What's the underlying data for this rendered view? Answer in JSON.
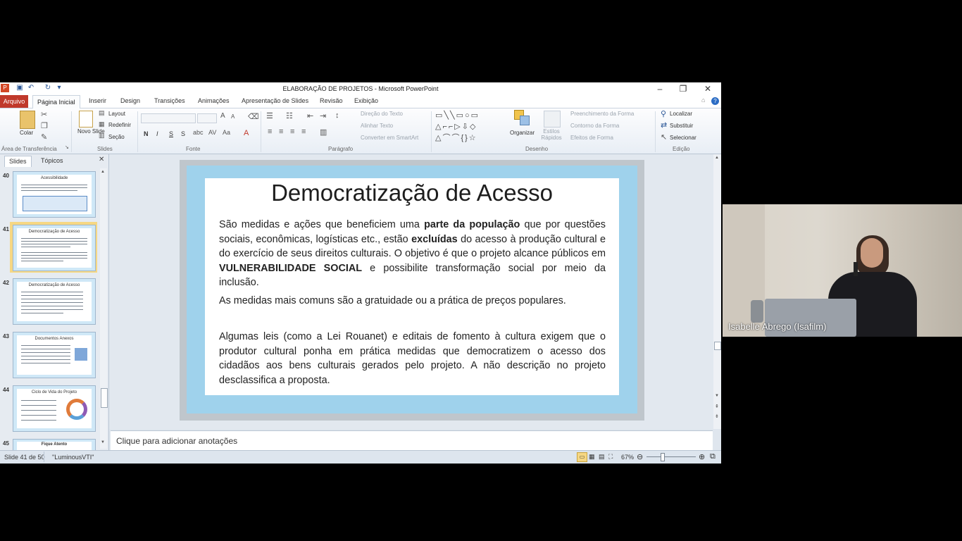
{
  "window": {
    "title": "ELABORAÇÃO DE PROJETOS - Microsoft PowerPoint",
    "controls": {
      "minimize": "–",
      "restore": "❐",
      "close": "✕"
    }
  },
  "tabs": {
    "file": "Arquivo",
    "items": [
      "Página Inicial",
      "Inserir",
      "Design",
      "Transições",
      "Animações",
      "Apresentação de Slides",
      "Revisão",
      "Exibição"
    ]
  },
  "ribbon": {
    "clipboard": {
      "paste": "Colar",
      "group": "Área de Transferência"
    },
    "slides": {
      "new_slide": "Novo Slide",
      "layout": "Layout",
      "reset": "Redefinir",
      "section": "Seção",
      "group": "Slides"
    },
    "font": {
      "group": "Fonte",
      "bold": "N",
      "italic": "I",
      "underline": "S",
      "shadow": "S"
    },
    "paragraph": {
      "text_direction": "Direção do Texto",
      "align_text": "Alinhar Texto",
      "convert_smartart": "Converter em SmartArt",
      "group": "Parágrafo"
    },
    "drawing": {
      "arrange": "Organizar",
      "quick_styles": "Estilos Rápidos",
      "shape_fill": "Preenchimento da Forma",
      "shape_outline": "Contorno da Forma",
      "shape_effects": "Efeitos de Forma",
      "group": "Desenho"
    },
    "editing": {
      "find": "Localizar",
      "replace": "Substituir",
      "select": "Selecionar",
      "group": "Edição"
    }
  },
  "left_pane": {
    "tabs": [
      "Slides",
      "Tópicos"
    ],
    "thumbnails": [
      {
        "num": "40",
        "title": "Acessibilidade"
      },
      {
        "num": "41",
        "title": "Democratização de Acesso"
      },
      {
        "num": "42",
        "title": "Democratização de Acesso"
      },
      {
        "num": "43",
        "title": "Documentos Anexos"
      },
      {
        "num": "44",
        "title": "Ciclo de Vida do Projeto"
      },
      {
        "num": "45",
        "title": "Fique Atento"
      }
    ]
  },
  "slide": {
    "title": "Democratização de Acesso",
    "p1": {
      "a": "São medidas e ações que beneficiem uma ",
      "b": "parte da população",
      "c": " que por questões sociais, econômicas, logísticas etc., estão ",
      "d": "excluídas",
      "e": " do acesso à produção cultural e do exercício de seus direitos culturais. O objetivo é que o projeto alcance públicos em ",
      "f": "VULNERABILIDADE SOCIAL",
      "g": " e possibilite transformação social por meio da inclusão."
    },
    "p2": "As medidas mais comuns são a gratuidade ou a prática de preços populares.",
    "p3": "Algumas leis (como a Lei Rouanet) e editais de fomento à cultura exigem que o produtor cultural ponha em prática medidas que democratizem o acesso dos cidadãos aos bens culturais gerados pelo projeto. A não descrição no projeto desclassifica a proposta."
  },
  "notes_placeholder": "Clique para adicionar anotações",
  "status": {
    "slide_info": "Slide 41 de 50",
    "theme": "\"LuminousVTI\"",
    "zoom": "67%",
    "zoom_fraction": 0.67
  },
  "webcam": {
    "name": "Isabelle Abrego (Isafilm)"
  },
  "colors": {
    "file_tab": "#c0392b",
    "slide_frame": "#9fd2ec",
    "selected_thumb": "#f6d783"
  }
}
